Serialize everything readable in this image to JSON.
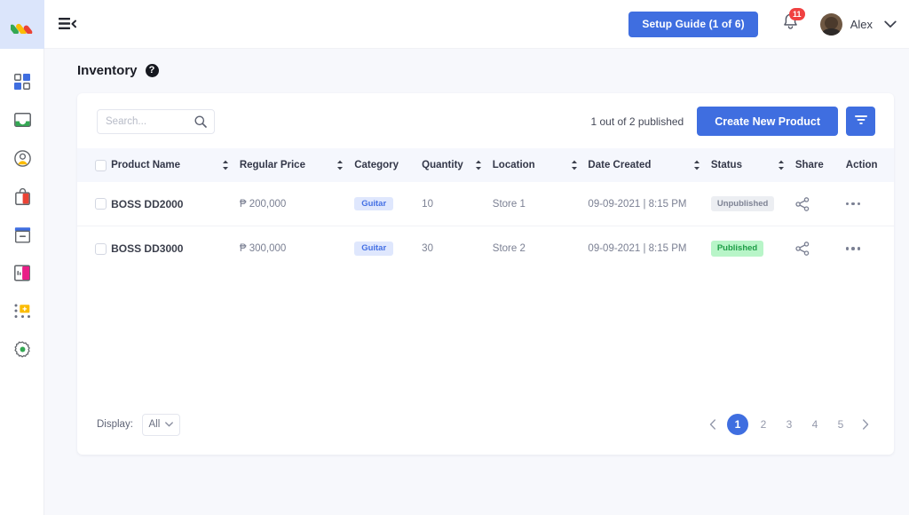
{
  "brand": {
    "logo_name": "app-logo",
    "accent": "#3f6ee0"
  },
  "sidebar": {
    "items": [
      {
        "icon": "dashboard-grid-icon",
        "label": "Dashboard"
      },
      {
        "icon": "inbox-icon",
        "label": "Inbox"
      },
      {
        "icon": "account-circle-icon",
        "label": "Account"
      },
      {
        "icon": "shopping-bag-icon",
        "label": "Shop"
      },
      {
        "icon": "inventory-box-icon",
        "label": "Inventory"
      },
      {
        "icon": "book-icon",
        "label": "Catalog"
      },
      {
        "icon": "apps-grid-icon",
        "label": "Apps"
      },
      {
        "icon": "gear-icon",
        "label": "Settings"
      }
    ]
  },
  "header": {
    "menu_toggle": "collapse-menu-icon",
    "setup_guide_label": "Setup Guide (1 of 6)",
    "notifications": {
      "icon": "bell-icon",
      "count": "11"
    },
    "user": {
      "name": "Alex",
      "avatar": "user-avatar",
      "caret": "chevron-down-icon"
    }
  },
  "page": {
    "title": "Inventory",
    "help_icon_label": "?"
  },
  "toolbar": {
    "search": {
      "value": "",
      "placeholder": "Search...",
      "icon": "search-icon"
    },
    "published_status": "1 out of 2 published",
    "create_label": "Create New Product",
    "filter_icon": "filter-icon"
  },
  "table": {
    "columns": [
      {
        "label": "Product Name",
        "sortable": true
      },
      {
        "label": "Regular Price",
        "sortable": true
      },
      {
        "label": "Category",
        "sortable": false
      },
      {
        "label": "Quantity",
        "sortable": true
      },
      {
        "label": "Location",
        "sortable": true
      },
      {
        "label": "Date Created",
        "sortable": true
      },
      {
        "label": "Status",
        "sortable": true
      },
      {
        "label": "Share",
        "sortable": false
      },
      {
        "label": "Action",
        "sortable": false
      }
    ],
    "rows": [
      {
        "name": "BOSS DD2000",
        "price": "₱ 200,000",
        "category": "Guitar",
        "quantity": "10",
        "location": "Store 1",
        "date_created": "09-09-2021 | 8:15 PM",
        "status": "Unpublished",
        "status_kind": "unpublished",
        "share_icon": "share-icon",
        "action_icon": "more-options-icon"
      },
      {
        "name": "BOSS DD3000",
        "price": "₱ 300,000",
        "category": "Guitar",
        "quantity": "30",
        "location": "Store 2",
        "date_created": "09-09-2021 | 8:15 PM",
        "status": "Published",
        "status_kind": "published",
        "share_icon": "share-icon",
        "action_icon": "more-options-icon"
      }
    ]
  },
  "footer": {
    "display_label": "Display:",
    "display_value": "All",
    "pagination": {
      "prev_icon": "chevron-left-icon",
      "next_icon": "chevron-right-icon",
      "pages": [
        "1",
        "2",
        "3",
        "4",
        "5"
      ],
      "active": "1"
    }
  },
  "colors": {
    "primary_blue": "#3f6ee0",
    "badge_category_bg": "#dfe7fd",
    "badge_category_text": "#4470e4",
    "badge_published_bg": "#b8f5c8",
    "badge_published_text": "#1f9e47",
    "badge_unpublished_bg": "#eceef2",
    "badge_unpublished_text": "#7e8394",
    "notification_red": "#f04141",
    "page_bg": "#f7f8fc"
  }
}
